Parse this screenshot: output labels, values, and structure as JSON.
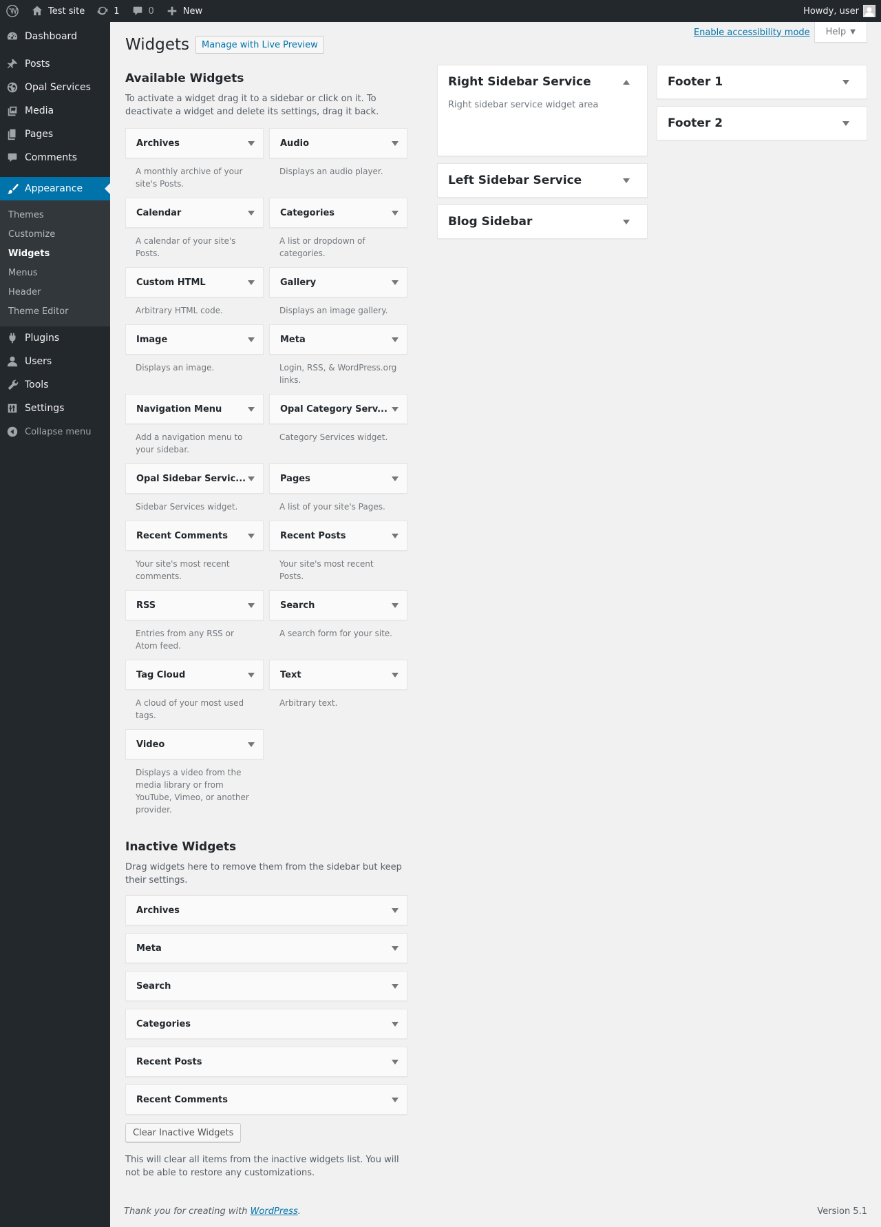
{
  "adminbar": {
    "site_name": "Test site",
    "updates_count": "1",
    "comments_count": "0",
    "new_label": "New",
    "howdy": "Howdy, user"
  },
  "menu": {
    "dashboard": "Dashboard",
    "posts": "Posts",
    "opal_services": "Opal Services",
    "media": "Media",
    "pages": "Pages",
    "comments": "Comments",
    "appearance": "Appearance",
    "sub": [
      "Themes",
      "Customize",
      "Widgets",
      "Menus",
      "Header",
      "Theme Editor"
    ],
    "plugins": "Plugins",
    "users": "Users",
    "tools": "Tools",
    "settings": "Settings",
    "collapse": "Collapse menu"
  },
  "screen_meta": {
    "a11y": "Enable accessibility mode",
    "help": "Help"
  },
  "page": {
    "title": "Widgets",
    "live_preview": "Manage with Live Preview"
  },
  "available": {
    "title": "Available Widgets",
    "desc": "To activate a widget drag it to a sidebar or click on it. To deactivate a widget and delete its settings, drag it back.",
    "widgets": [
      {
        "name": "Archives",
        "desc": "A monthly archive of your site's Posts."
      },
      {
        "name": "Audio",
        "desc": "Displays an audio player."
      },
      {
        "name": "Calendar",
        "desc": "A calendar of your site's Posts."
      },
      {
        "name": "Categories",
        "desc": "A list or dropdown of categories."
      },
      {
        "name": "Custom HTML",
        "desc": "Arbitrary HTML code."
      },
      {
        "name": "Gallery",
        "desc": "Displays an image gallery."
      },
      {
        "name": "Image",
        "desc": "Displays an image."
      },
      {
        "name": "Meta",
        "desc": "Login, RSS, & WordPress.org links."
      },
      {
        "name": "Navigation Menu",
        "desc": "Add a navigation menu to your sidebar."
      },
      {
        "name": "Opal Category Serv...",
        "desc": "Category Services widget."
      },
      {
        "name": "Opal Sidebar Servic...",
        "desc": "Sidebar Services widget."
      },
      {
        "name": "Pages",
        "desc": "A list of your site's Pages."
      },
      {
        "name": "Recent Comments",
        "desc": "Your site's most recent comments."
      },
      {
        "name": "Recent Posts",
        "desc": "Your site's most recent Posts."
      },
      {
        "name": "RSS",
        "desc": "Entries from any RSS or Atom feed."
      },
      {
        "name": "Search",
        "desc": "A search form for your site."
      },
      {
        "name": "Tag Cloud",
        "desc": "A cloud of your most used tags."
      },
      {
        "name": "Text",
        "desc": "Arbitrary text."
      },
      {
        "name": "Video",
        "desc": "Displays a video from the media library or from YouTube, Vimeo, or another provider."
      }
    ]
  },
  "inactive": {
    "title": "Inactive Widgets",
    "desc": "Drag widgets here to remove them from the sidebar but keep their settings.",
    "widgets": [
      "Archives",
      "Meta",
      "Search",
      "Categories",
      "Recent Posts",
      "Recent Comments"
    ],
    "clear_label": "Clear Inactive Widgets",
    "clear_desc": "This will clear all items from the inactive widgets list. You will not be able to restore any customizations."
  },
  "sidebars": {
    "right_service": {
      "title": "Right Sidebar Service",
      "desc": "Right sidebar service widget area"
    },
    "left_service": {
      "title": "Left Sidebar Service"
    },
    "blog": {
      "title": "Blog Sidebar"
    },
    "footer1": {
      "title": "Footer 1"
    },
    "footer2": {
      "title": "Footer 2"
    }
  },
  "footer": {
    "thanks": "Thank you for creating with ",
    "wp_link": "WordPress",
    "period": ".",
    "version": "Version 5.1"
  }
}
